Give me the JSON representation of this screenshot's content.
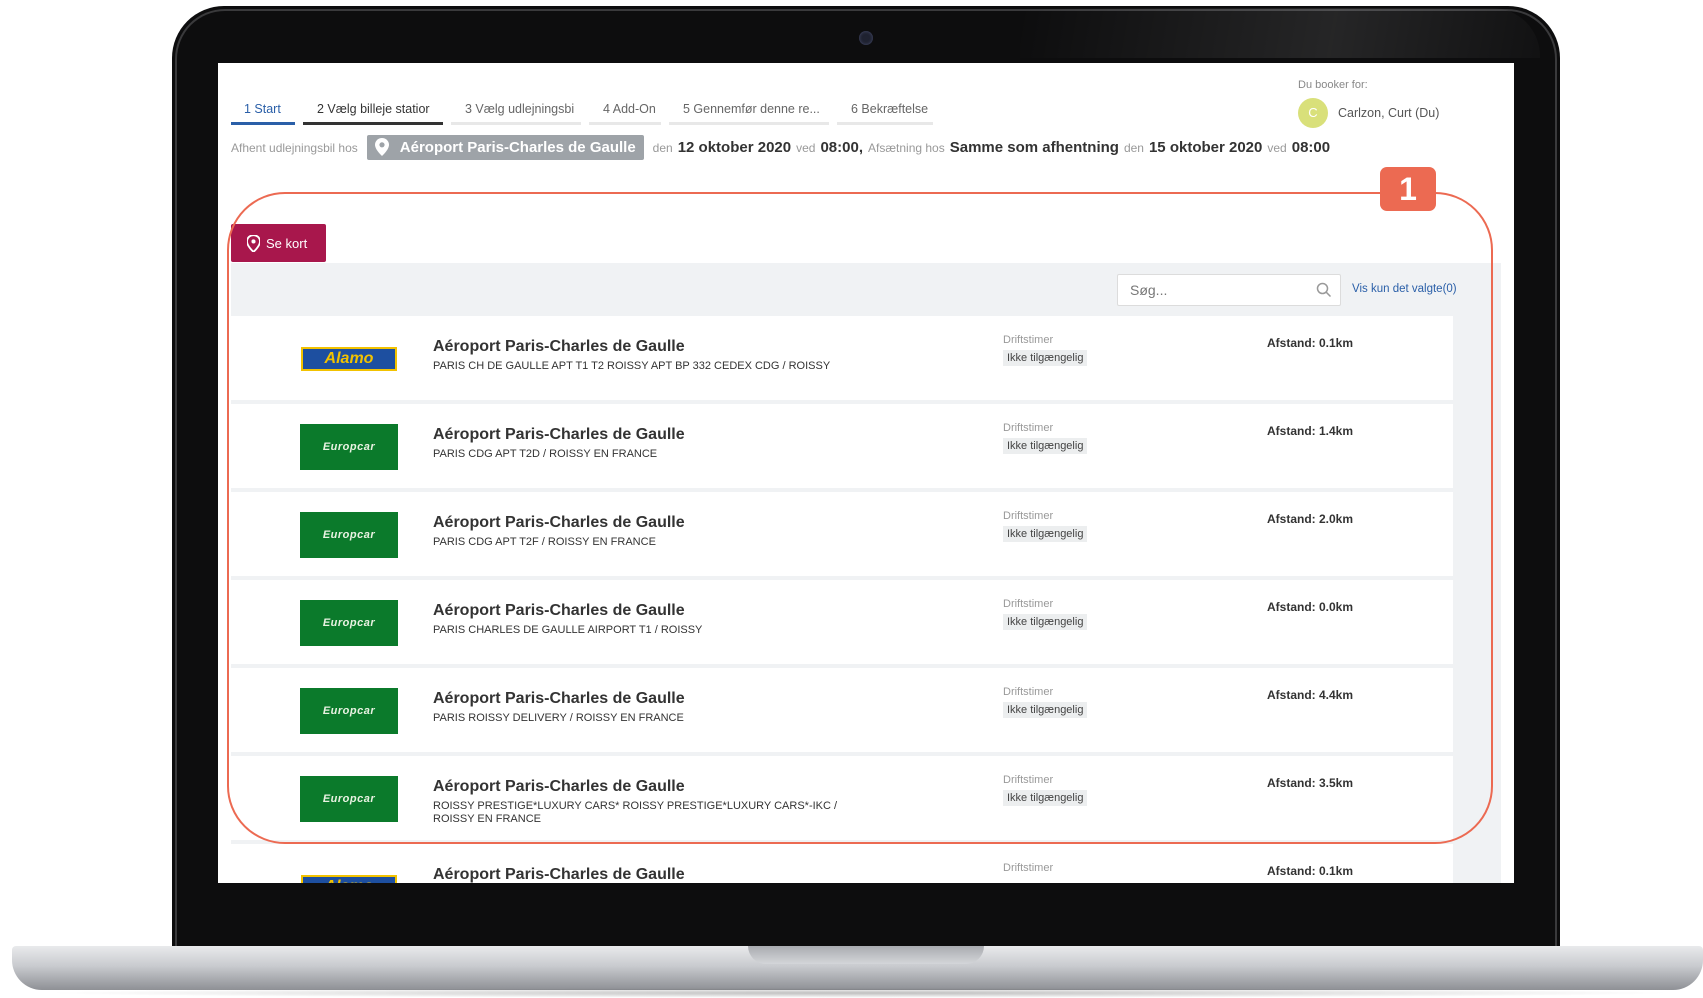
{
  "tabs": [
    {
      "label": "1  Start",
      "state": "active"
    },
    {
      "label": "2  Vælg billeje statior",
      "state": "done"
    },
    {
      "label": "3  Vælg udlejningsbi",
      "state": "pending"
    },
    {
      "label": "4  Add-On",
      "state": "pending"
    },
    {
      "label": "5  Gennemfør denne re...",
      "state": "pending"
    },
    {
      "label": "6  Bekræftelse",
      "state": "pending"
    }
  ],
  "booker": {
    "label": "Du booker for:",
    "avatar_initial": "C",
    "name": "Carlzon, Curt (Du)"
  },
  "summary": {
    "pickup_prefix": "Afhent udlejningsbil hos",
    "pickup_location": "Aéroport Paris-Charles de Gaulle",
    "den1": "den",
    "pickup_date": "12 oktober 2020",
    "ved1": "ved",
    "pickup_time": "08:00,",
    "dropoff_prefix": "Afsætning hos",
    "dropoff_location": "Samme som afhentning",
    "den2": "den",
    "dropoff_date": "15 oktober 2020",
    "ved2": "ved",
    "dropoff_time": "08:00"
  },
  "map_button": {
    "label": "Se kort",
    "color": "#a8174c"
  },
  "search": {
    "placeholder": "Søg...",
    "show_selected": "Vis kun det valgte(0)"
  },
  "stations": [
    {
      "brand": "Alamo",
      "logo_text": "Alamo",
      "title": "Aéroport Paris-Charles de Gaulle",
      "address": "PARIS CH DE GAULLE APT T1 T2 ROISSY APT BP 332 CEDEX CDG / ROISSY",
      "hours_label": "Driftstimer",
      "hours_value": "Ikke tilgængelig",
      "distance": "Afstand: 0.1km"
    },
    {
      "brand": "Europcar",
      "logo_text": "Europcar",
      "title": "Aéroport Paris-Charles de Gaulle",
      "address": "PARIS CDG APT T2D / ROISSY EN FRANCE",
      "hours_label": "Driftstimer",
      "hours_value": "Ikke tilgængelig",
      "distance": "Afstand: 1.4km"
    },
    {
      "brand": "Europcar",
      "logo_text": "Europcar",
      "title": "Aéroport Paris-Charles de Gaulle",
      "address": "PARIS CDG APT T2F / ROISSY EN FRANCE",
      "hours_label": "Driftstimer",
      "hours_value": "Ikke tilgængelig",
      "distance": "Afstand: 2.0km"
    },
    {
      "brand": "Europcar",
      "logo_text": "Europcar",
      "title": "Aéroport Paris-Charles de Gaulle",
      "address": "PARIS CHARLES DE GAULLE AIRPORT T1 / ROISSY",
      "hours_label": "Driftstimer",
      "hours_value": "Ikke tilgængelig",
      "distance": "Afstand: 0.0km"
    },
    {
      "brand": "Europcar",
      "logo_text": "Europcar",
      "title": "Aéroport Paris-Charles de Gaulle",
      "address": "PARIS ROISSY DELIVERY / ROISSY EN FRANCE",
      "hours_label": "Driftstimer",
      "hours_value": "Ikke tilgængelig",
      "distance": "Afstand: 4.4km"
    },
    {
      "brand": "Europcar",
      "logo_text": "Europcar",
      "title": "Aéroport Paris-Charles de Gaulle",
      "address": "ROISSY PRESTIGE*LUXURY CARS* ROISSY PRESTIGE*LUXURY CARS*-IKC / ROISSY EN FRANCE",
      "hours_label": "Driftstimer",
      "hours_value": "Ikke tilgængelig",
      "distance": "Afstand: 3.5km"
    },
    {
      "brand": "Alamo",
      "logo_text": "Alamo",
      "title": "Aéroport Paris-Charles de Gaulle",
      "address": "",
      "hours_label": "Driftstimer",
      "hours_value": "",
      "distance": "Afstand: 0.1km"
    }
  ],
  "callout": {
    "number": "1",
    "color": "#ec6a52"
  }
}
